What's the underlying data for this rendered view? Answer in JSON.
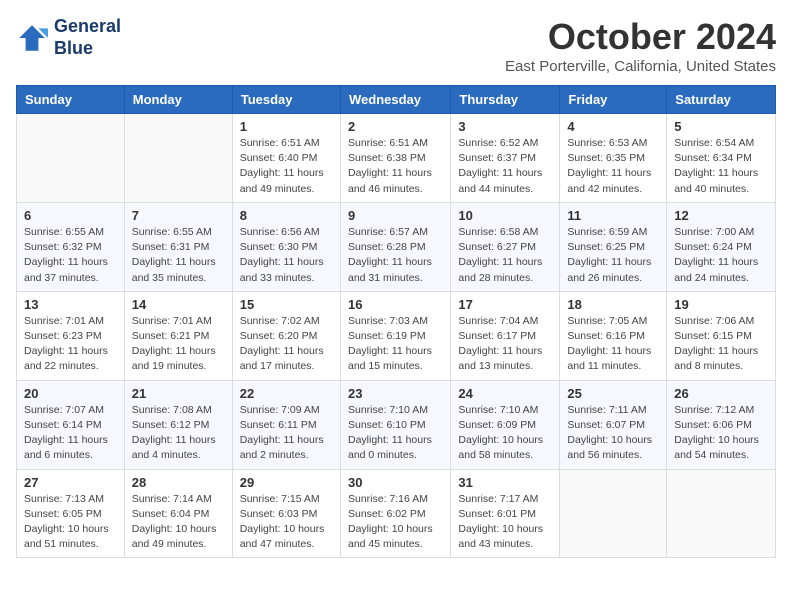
{
  "logo": {
    "line1": "General",
    "line2": "Blue"
  },
  "title": "October 2024",
  "location": "East Porterville, California, United States",
  "weekdays": [
    "Sunday",
    "Monday",
    "Tuesday",
    "Wednesday",
    "Thursday",
    "Friday",
    "Saturday"
  ],
  "weeks": [
    [
      {
        "day": "",
        "info": ""
      },
      {
        "day": "",
        "info": ""
      },
      {
        "day": "1",
        "info": "Sunrise: 6:51 AM\nSunset: 6:40 PM\nDaylight: 11 hours\nand 49 minutes."
      },
      {
        "day": "2",
        "info": "Sunrise: 6:51 AM\nSunset: 6:38 PM\nDaylight: 11 hours\nand 46 minutes."
      },
      {
        "day": "3",
        "info": "Sunrise: 6:52 AM\nSunset: 6:37 PM\nDaylight: 11 hours\nand 44 minutes."
      },
      {
        "day": "4",
        "info": "Sunrise: 6:53 AM\nSunset: 6:35 PM\nDaylight: 11 hours\nand 42 minutes."
      },
      {
        "day": "5",
        "info": "Sunrise: 6:54 AM\nSunset: 6:34 PM\nDaylight: 11 hours\nand 40 minutes."
      }
    ],
    [
      {
        "day": "6",
        "info": "Sunrise: 6:55 AM\nSunset: 6:32 PM\nDaylight: 11 hours\nand 37 minutes."
      },
      {
        "day": "7",
        "info": "Sunrise: 6:55 AM\nSunset: 6:31 PM\nDaylight: 11 hours\nand 35 minutes."
      },
      {
        "day": "8",
        "info": "Sunrise: 6:56 AM\nSunset: 6:30 PM\nDaylight: 11 hours\nand 33 minutes."
      },
      {
        "day": "9",
        "info": "Sunrise: 6:57 AM\nSunset: 6:28 PM\nDaylight: 11 hours\nand 31 minutes."
      },
      {
        "day": "10",
        "info": "Sunrise: 6:58 AM\nSunset: 6:27 PM\nDaylight: 11 hours\nand 28 minutes."
      },
      {
        "day": "11",
        "info": "Sunrise: 6:59 AM\nSunset: 6:25 PM\nDaylight: 11 hours\nand 26 minutes."
      },
      {
        "day": "12",
        "info": "Sunrise: 7:00 AM\nSunset: 6:24 PM\nDaylight: 11 hours\nand 24 minutes."
      }
    ],
    [
      {
        "day": "13",
        "info": "Sunrise: 7:01 AM\nSunset: 6:23 PM\nDaylight: 11 hours\nand 22 minutes."
      },
      {
        "day": "14",
        "info": "Sunrise: 7:01 AM\nSunset: 6:21 PM\nDaylight: 11 hours\nand 19 minutes."
      },
      {
        "day": "15",
        "info": "Sunrise: 7:02 AM\nSunset: 6:20 PM\nDaylight: 11 hours\nand 17 minutes."
      },
      {
        "day": "16",
        "info": "Sunrise: 7:03 AM\nSunset: 6:19 PM\nDaylight: 11 hours\nand 15 minutes."
      },
      {
        "day": "17",
        "info": "Sunrise: 7:04 AM\nSunset: 6:17 PM\nDaylight: 11 hours\nand 13 minutes."
      },
      {
        "day": "18",
        "info": "Sunrise: 7:05 AM\nSunset: 6:16 PM\nDaylight: 11 hours\nand 11 minutes."
      },
      {
        "day": "19",
        "info": "Sunrise: 7:06 AM\nSunset: 6:15 PM\nDaylight: 11 hours\nand 8 minutes."
      }
    ],
    [
      {
        "day": "20",
        "info": "Sunrise: 7:07 AM\nSunset: 6:14 PM\nDaylight: 11 hours\nand 6 minutes."
      },
      {
        "day": "21",
        "info": "Sunrise: 7:08 AM\nSunset: 6:12 PM\nDaylight: 11 hours\nand 4 minutes."
      },
      {
        "day": "22",
        "info": "Sunrise: 7:09 AM\nSunset: 6:11 PM\nDaylight: 11 hours\nand 2 minutes."
      },
      {
        "day": "23",
        "info": "Sunrise: 7:10 AM\nSunset: 6:10 PM\nDaylight: 11 hours\nand 0 minutes."
      },
      {
        "day": "24",
        "info": "Sunrise: 7:10 AM\nSunset: 6:09 PM\nDaylight: 10 hours\nand 58 minutes."
      },
      {
        "day": "25",
        "info": "Sunrise: 7:11 AM\nSunset: 6:07 PM\nDaylight: 10 hours\nand 56 minutes."
      },
      {
        "day": "26",
        "info": "Sunrise: 7:12 AM\nSunset: 6:06 PM\nDaylight: 10 hours\nand 54 minutes."
      }
    ],
    [
      {
        "day": "27",
        "info": "Sunrise: 7:13 AM\nSunset: 6:05 PM\nDaylight: 10 hours\nand 51 minutes."
      },
      {
        "day": "28",
        "info": "Sunrise: 7:14 AM\nSunset: 6:04 PM\nDaylight: 10 hours\nand 49 minutes."
      },
      {
        "day": "29",
        "info": "Sunrise: 7:15 AM\nSunset: 6:03 PM\nDaylight: 10 hours\nand 47 minutes."
      },
      {
        "day": "30",
        "info": "Sunrise: 7:16 AM\nSunset: 6:02 PM\nDaylight: 10 hours\nand 45 minutes."
      },
      {
        "day": "31",
        "info": "Sunrise: 7:17 AM\nSunset: 6:01 PM\nDaylight: 10 hours\nand 43 minutes."
      },
      {
        "day": "",
        "info": ""
      },
      {
        "day": "",
        "info": ""
      }
    ]
  ]
}
